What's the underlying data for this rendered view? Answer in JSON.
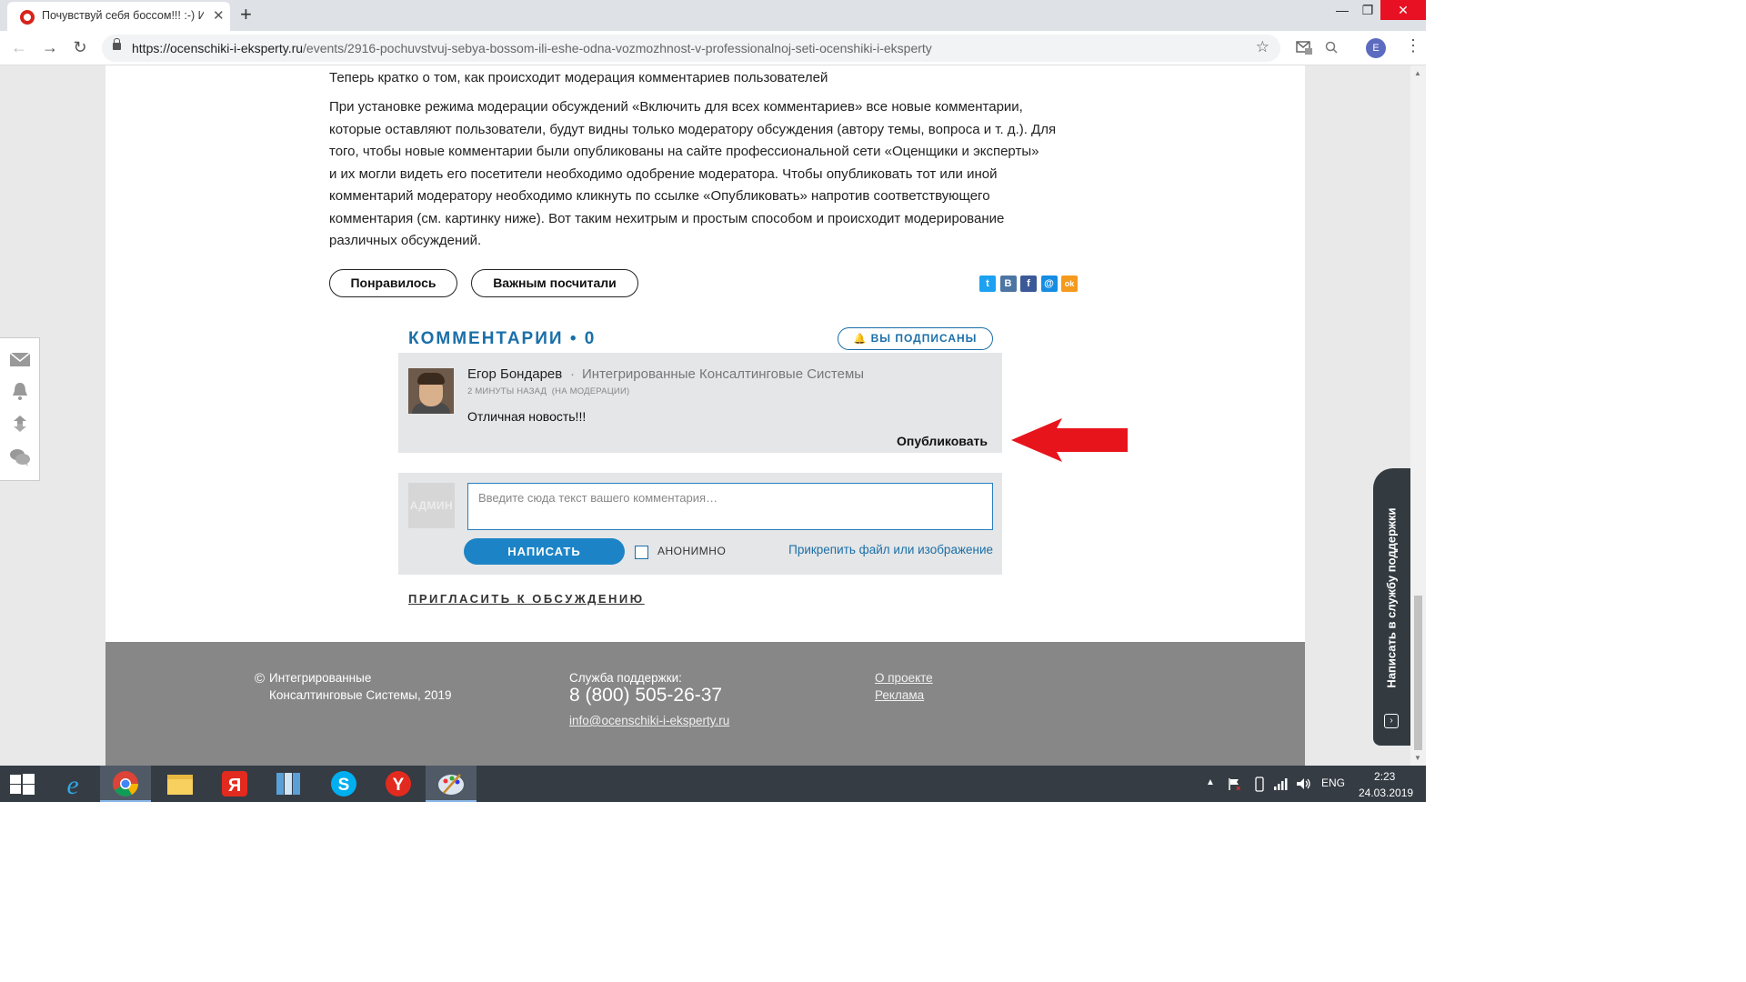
{
  "browser": {
    "tab_title": "Почувствуй себя боссом!!! :-) И",
    "tab_close": "✕",
    "new_tab": "+",
    "window_controls": {
      "minimize": "—",
      "maximize": "❐",
      "close": "✕"
    },
    "url_domain": "https://ocenschiki-i-eksperty.ru",
    "url_path": "/events/2916-pochuvstvuj-sebya-bossom-ili-eshe-odna-vozmozhnost-v-professionalnoj-seti-ocenshiki-i-eksperty",
    "profile_initial": "E"
  },
  "article": {
    "heading": "Теперь кратко о том, как происходит модерация комментариев пользователей",
    "body_lines": [
      "При установке режима модерации обсуждений «Включить для всех комментариев» все новые комментарии,",
      "которые оставляют пользователи, будут видны только модератору обсуждения (автору темы, вопроса и т. д.). Для",
      "того, чтобы новые комментарии были опубликованы на сайте профессиональной сети «Оценщики и эксперты»",
      "и их могли видеть его посетители необходимо одобрение модератора. Чтобы опубликовать тот или иной",
      "комментарий модератору необходимо кликнуть по ссылке «Опубликовать» напротив соответствующего",
      "комментария (см. картинку ниже). Вот таким нехитрым и простым способом и происходит модерирование",
      "различных обсуждений."
    ],
    "like_button": "Понравилось",
    "important_button": "Важным посчитали",
    "share_icons": [
      {
        "name": "twitter-share-icon",
        "glyph": "t",
        "color": "#1da1f2"
      },
      {
        "name": "vk-share-icon",
        "glyph": "B",
        "color": "#4c75a3"
      },
      {
        "name": "facebook-share-icon",
        "glyph": "f",
        "color": "#3b5998"
      },
      {
        "name": "mailru-share-icon",
        "glyph": "@",
        "color": "#168de2"
      },
      {
        "name": "odnoklassniki-share-icon",
        "glyph": "ok",
        "color": "#f59a1d"
      }
    ]
  },
  "comments": {
    "title": "КОММЕНТАРИИ • 0",
    "subscribed": "ВЫ ПОДПИСАНЫ",
    "item": {
      "author": "Егор Бондарев",
      "company": "Интегрированные Консалтинговые Системы",
      "meta": "2 МИНУТЫ НАЗАД  (НА МОДЕРАЦИИ)",
      "text": "Отличная новость!!!",
      "publish": "Опубликовать"
    },
    "form": {
      "avatar_label": "АДМИН",
      "placeholder": "Введите сюда текст вашего комментария…",
      "submit": "НАПИСАТЬ",
      "anonymous": "АНОНИМНО",
      "attach": "Прикрепить файл или изображение"
    },
    "invite": "ПРИГЛАСИТЬ К ОБСУЖДЕНИЮ"
  },
  "support_tab": "Написать в службу поддержки",
  "footer": {
    "copyright_line1": "Интегрированные",
    "copyright_line2": "Консалтинговые Системы, 2019",
    "support_label": "Служба поддержки:",
    "phone": "8 (800) 505-26-37",
    "email": "info@ocenschiki-i-eksperty.ru",
    "link_about": "О проекте",
    "link_ads": "Реклама"
  },
  "taskbar": {
    "language": "ENG",
    "time": "2:23",
    "date": "24.03.2019"
  },
  "colors": {
    "accent": "#1b6fa8",
    "arrow": "#e8141c",
    "footer_bg": "#878787"
  }
}
